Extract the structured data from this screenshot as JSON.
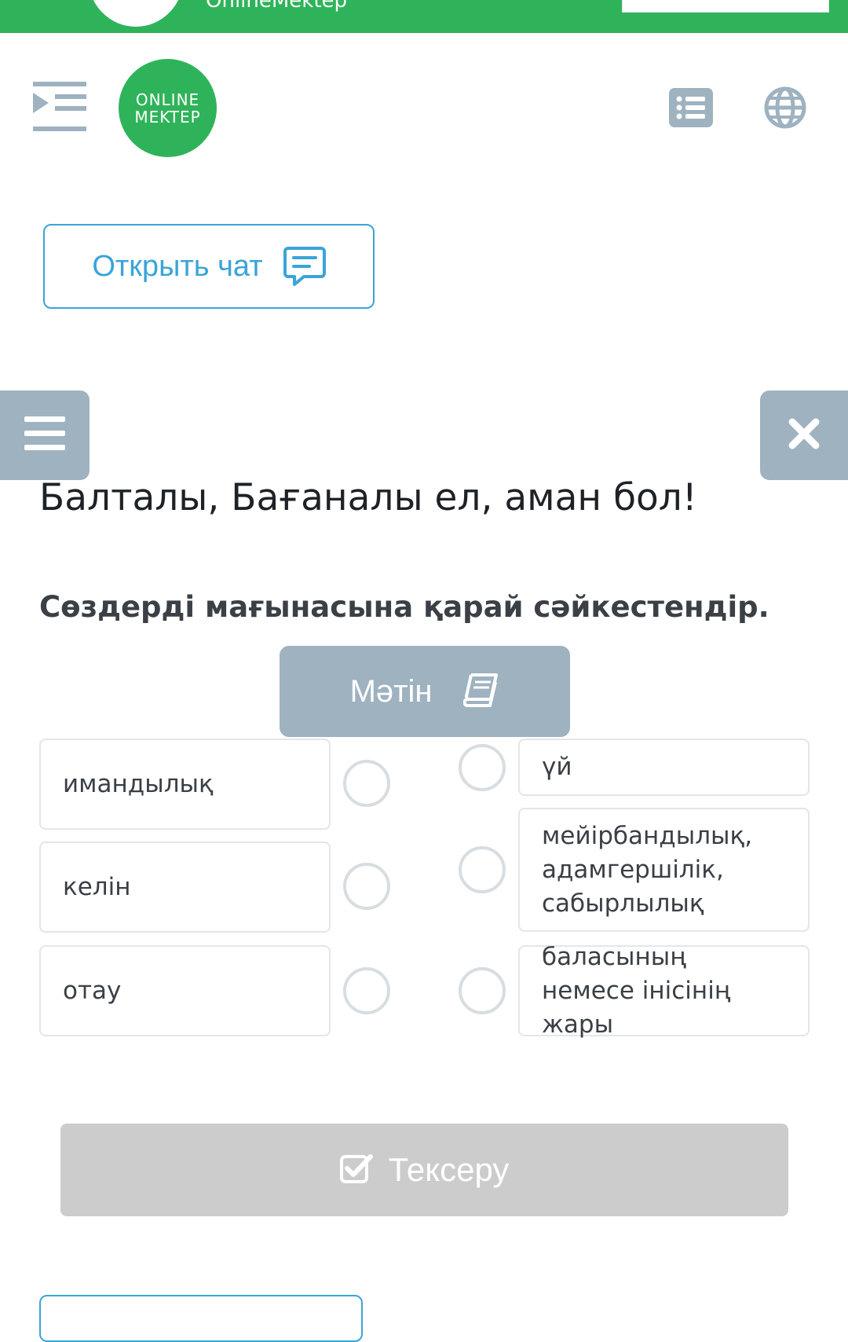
{
  "top_banner": {
    "brand_text": "OnlineMektep"
  },
  "header": {
    "logo_line1": "ONLINE",
    "logo_line2": "MEKTEP",
    "menu_toggle_icon": "indent-menu-icon",
    "list_icon": "list-icon",
    "globe_icon": "globe-icon",
    "brand_color": "#2fb35a"
  },
  "chat": {
    "open_label": "Открыть чат",
    "icon": "chat-message-icon",
    "accent": "#3aa4d9"
  },
  "controls": {
    "side_menu_icon": "hamburger-icon",
    "close_icon": "close-icon"
  },
  "lesson": {
    "title": "Балталы, Бағаналы ел, аман бол!",
    "instruction": "Сөздерді мағынасына қарай сәйкестендір.",
    "text_button_label": "Мәтін",
    "text_button_icon": "book-icon"
  },
  "matching": {
    "left": [
      {
        "label": "имандылық"
      },
      {
        "label": "келін"
      },
      {
        "label": "отау"
      }
    ],
    "right": [
      {
        "label": "үй"
      },
      {
        "label": "мейірбандылық, адамгершілік, сабырлылық"
      },
      {
        "label": "баласының немесе інісінің жары"
      }
    ]
  },
  "check": {
    "label": "Тексеру",
    "icon": "check-square-icon"
  }
}
